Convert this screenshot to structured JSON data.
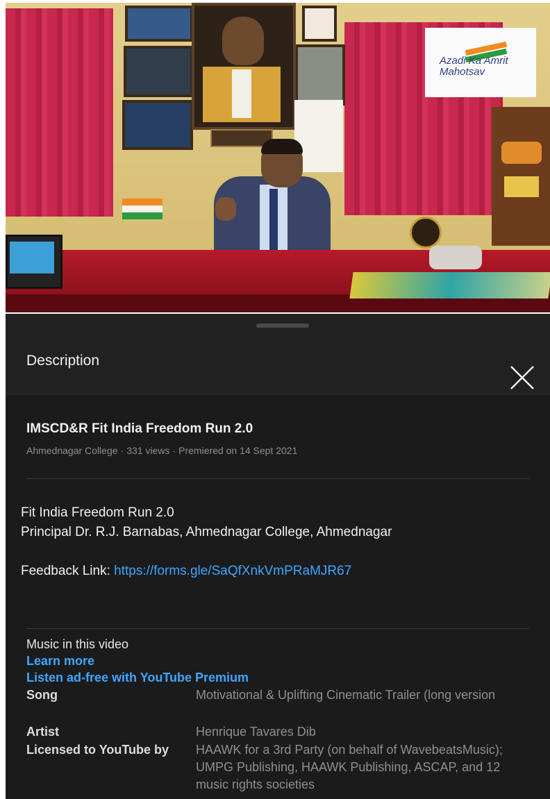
{
  "video": {
    "overlay_logo_text": "Azadi Ka Amrit Mahotsav"
  },
  "description_panel": {
    "title": "Description",
    "close_icon": "close-icon"
  },
  "video_info": {
    "title": "IMSCD&R Fit India Freedom Run 2.0",
    "channel": "Ahmednagar College",
    "views": "331 views",
    "premiered": "Premiered on 14 Sept 2021"
  },
  "description": {
    "line1": "Fit India Freedom Run 2.0",
    "line2": "Principal Dr. R.J. Barnabas, Ahmednagar College, Ahmednagar",
    "feedback_label": "Feedback Link: ",
    "feedback_url": "https://forms.gle/SaQfXnkVmPRaMJR67"
  },
  "music": {
    "heading": "Music in this video",
    "learn_more": "Learn more",
    "premium": "Listen ad-free with YouTube Premium",
    "song_label": "Song",
    "song_value": "Motivational & Uplifting Cinematic Trailer (long version",
    "artist_label": "Artist",
    "artist_value": "Henrique Tavares Dib",
    "licensed_label": "Licensed to YouTube by",
    "licensed_value": "HAAWK for a 3rd Party (on behalf of WavebeatsMusic); UMPG Publishing, HAAWK Publishing, ASCAP, and 12 music rights societies"
  }
}
